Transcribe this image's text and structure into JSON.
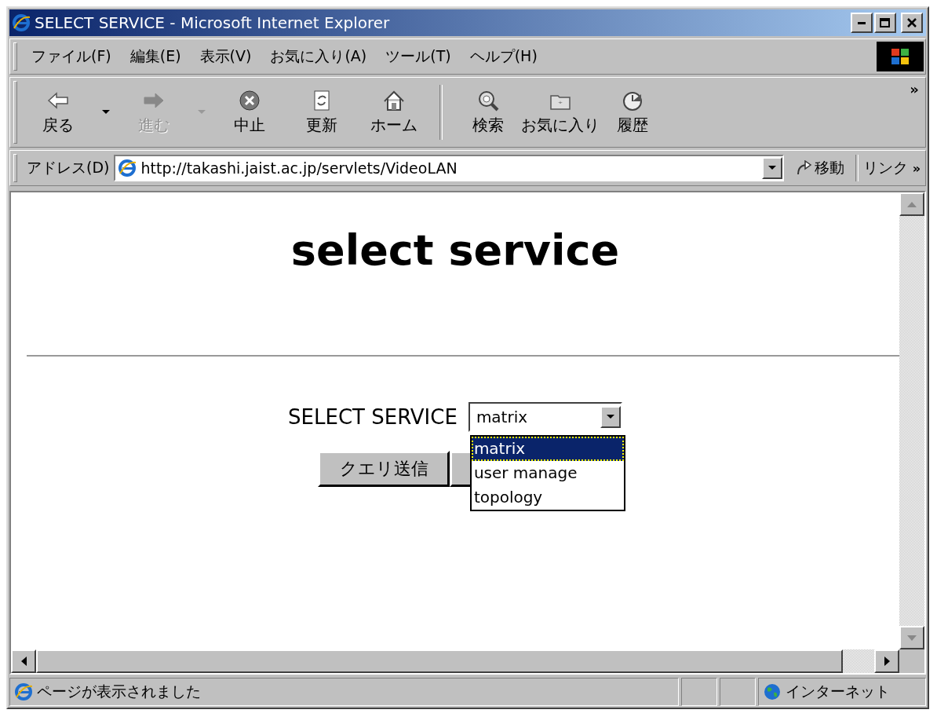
{
  "window": {
    "title": "SELECT SERVICE - Microsoft Internet Explorer"
  },
  "menu": [
    {
      "label": "ファイル(F)"
    },
    {
      "label": "編集(E)"
    },
    {
      "label": "表示(V)"
    },
    {
      "label": "お気に入り(A)"
    },
    {
      "label": "ツール(T)"
    },
    {
      "label": "ヘルプ(H)"
    }
  ],
  "toolbar": {
    "buttons": [
      {
        "kind": "back",
        "label": "戻る",
        "disabled": false,
        "dropdown": true
      },
      {
        "kind": "forward",
        "label": "進む",
        "disabled": true,
        "dropdown": true
      },
      {
        "kind": "stop",
        "label": "中止",
        "disabled": false,
        "dropdown": false
      },
      {
        "kind": "refresh",
        "label": "更新",
        "disabled": false,
        "dropdown": false
      },
      {
        "kind": "home",
        "label": "ホーム",
        "disabled": false,
        "dropdown": false
      },
      {
        "kind": "separator"
      },
      {
        "kind": "search",
        "label": "検索",
        "disabled": false,
        "dropdown": false
      },
      {
        "kind": "favorites",
        "label": "お気に入り",
        "disabled": false,
        "dropdown": false
      },
      {
        "kind": "history",
        "label": "履歴",
        "disabled": false,
        "dropdown": false
      }
    ],
    "overflow": "»"
  },
  "address_bar": {
    "label": "アドレス(D)",
    "url": "http://takashi.jaist.ac.jp/servlets/VideoLAN",
    "go": "移動",
    "links": "リンク",
    "links_overflow": "»"
  },
  "page": {
    "heading": "select service",
    "form": {
      "label": "SELECT SERVICE",
      "select": {
        "value": "matrix",
        "expanded": true,
        "options": [
          {
            "label": "matrix",
            "selected": true
          },
          {
            "label": "user manage",
            "selected": false
          },
          {
            "label": "topology",
            "selected": false
          }
        ]
      },
      "submit": "クエリ送信"
    }
  },
  "status_bar": {
    "text": "ページが表示されました",
    "zone": "インターネット"
  }
}
